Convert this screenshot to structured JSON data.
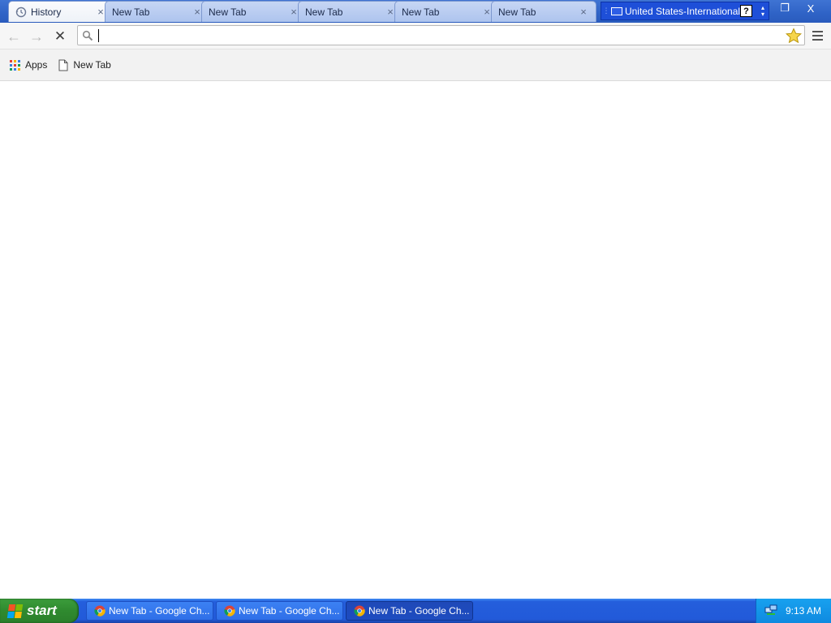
{
  "tabs": [
    {
      "title": "History",
      "icon": "history-icon",
      "active": true
    },
    {
      "title": "New Tab",
      "icon": "",
      "active": false
    },
    {
      "title": "New Tab",
      "icon": "",
      "active": false
    },
    {
      "title": "New Tab",
      "icon": "",
      "active": false
    },
    {
      "title": "New Tab",
      "icon": "",
      "active": false
    },
    {
      "title": "New Tab",
      "icon": "",
      "active": false
    }
  ],
  "tab_close_glyph": "×",
  "language_bar": {
    "label": "United States-International",
    "help": "?"
  },
  "window_controls": {
    "restore": "❐",
    "close": "X"
  },
  "toolbar": {
    "back": "←",
    "forward": "→",
    "stop": "✕",
    "omnibox_value": "",
    "omnibox_placeholder": ""
  },
  "bookmarks": [
    {
      "label": "Apps",
      "icon": "apps-grid-icon"
    },
    {
      "label": "New Tab",
      "icon": "page-icon"
    }
  ],
  "taskbar": {
    "start_label": "start",
    "tasks": [
      {
        "label": "New Tab - Google Ch...",
        "active": false
      },
      {
        "label": "New Tab - Google Ch...",
        "active": false
      },
      {
        "label": "New Tab - Google Ch...",
        "active": true
      }
    ],
    "clock": "9:13 AM"
  },
  "colors": {
    "tabstrip": "#2f63c6",
    "taskbar": "#245edc",
    "start_button": "#2f8a2f",
    "tray": "#0f8ae0"
  }
}
